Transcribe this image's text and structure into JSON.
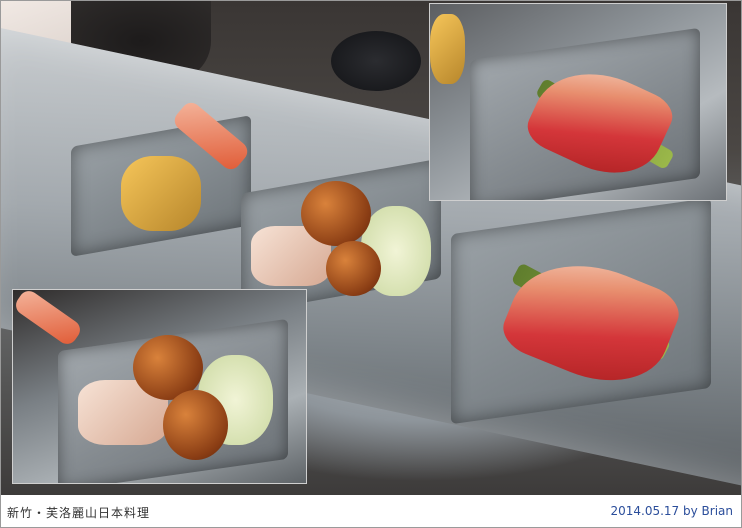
{
  "photo": {
    "alt": "",
    "caption_location": "新竹・芙洛麗山日本料理",
    "caption_credit": "2014.05.17 by Brian"
  },
  "colors": {
    "caption_text": "#333333",
    "credit_text": "#2b4e9b",
    "frame_border": "#9a9a9a"
  }
}
